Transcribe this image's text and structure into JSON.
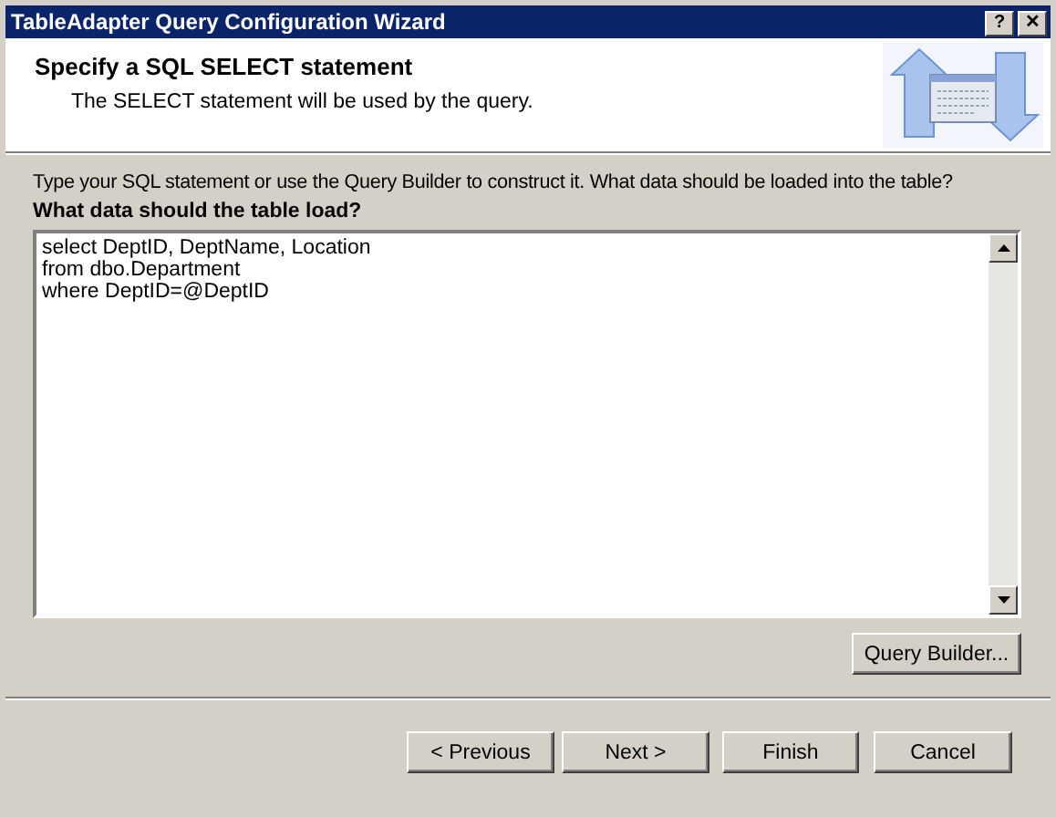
{
  "window": {
    "title": "TableAdapter Query Configuration Wizard",
    "title_buttons": [
      "?",
      "✕"
    ]
  },
  "header": {
    "title": "Specify a SQL SELECT statement",
    "subtitle": "The SELECT statement will be used by the query."
  },
  "instructions": "Type your SQL statement or use the Query Builder to construct it. What data should be loaded into the table?",
  "query": {
    "label": "What data should the table load?",
    "value": "select DeptID, DeptName, Location\nfrom dbo.Department\nwhere DeptID=@DeptID"
  },
  "query_builder_button": "Query Builder...",
  "buttons": [
    {
      "label": "< Previous",
      "disabled": false
    },
    {
      "label": "Next >",
      "disabled": false
    },
    {
      "label": "Finish",
      "disabled": false
    },
    {
      "label": "Cancel",
      "disabled": false
    }
  ]
}
